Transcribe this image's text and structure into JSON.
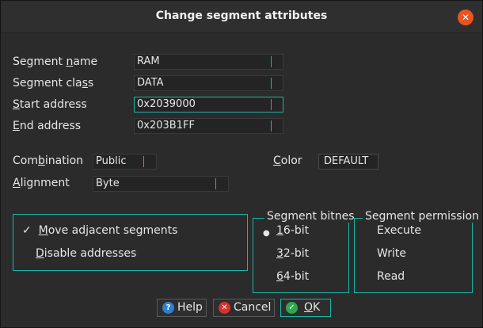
{
  "dialog": {
    "title": "Change segment attributes",
    "close_symbol": "✕"
  },
  "fields": {
    "segment_name": {
      "label_pre": "Segment ",
      "label_u": "n",
      "label_post": "ame",
      "value": "RAM"
    },
    "segment_class": {
      "label_pre": "Segment cla",
      "label_u": "s",
      "label_post": "s",
      "value": "DATA"
    },
    "start_address": {
      "label_pre": "",
      "label_u": "S",
      "label_post": "tart address",
      "value": "0x2039000"
    },
    "end_address": {
      "label_pre": "",
      "label_u": "E",
      "label_post": "nd address",
      "value": "0x203B1FF"
    }
  },
  "combination": {
    "label_pre": "Com",
    "label_u": "b",
    "label_post": "ination",
    "value": "Public"
  },
  "alignment": {
    "label_pre": "",
    "label_u": "A",
    "label_post": "lignment",
    "value": "Byte"
  },
  "color": {
    "label_pre": "",
    "label_u": "C",
    "label_post": "olor",
    "value": "DEFAULT"
  },
  "options": {
    "move_adjacent": {
      "check": "✓",
      "label_u": "M",
      "label_post": "ove adjacent segments"
    },
    "disable_addresses": {
      "label_u": "D",
      "label_post": "isable addresses"
    }
  },
  "bitness": {
    "title": "Segment bitness",
    "items": [
      {
        "u": "1",
        "rest": "6-bit",
        "selected": true
      },
      {
        "u": "3",
        "rest": "2-bit"
      },
      {
        "u": "6",
        "rest": "4-bit"
      }
    ]
  },
  "permissions": {
    "title": "Segment permissions",
    "items": [
      "Execute",
      "Write",
      "Read"
    ]
  },
  "buttons": {
    "help": {
      "icon": "?",
      "label": "Help"
    },
    "cancel": {
      "icon": "✕",
      "label": "Cancel"
    },
    "ok": {
      "icon": "✓",
      "label_u": "O",
      "label_post": "K"
    }
  }
}
